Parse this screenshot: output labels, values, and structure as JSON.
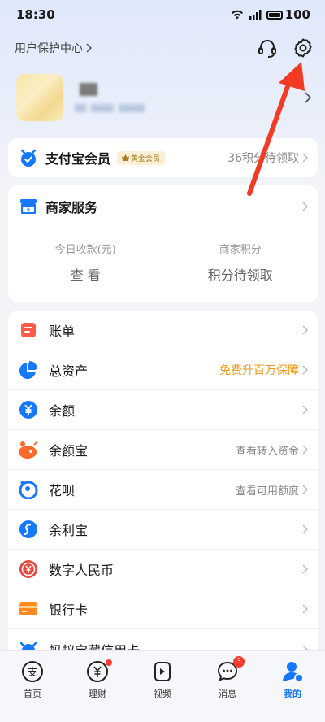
{
  "status_bar": {
    "time": "18:30",
    "battery": "100"
  },
  "header": {
    "protect_center": "用户保护中心"
  },
  "member": {
    "title": "支付宝会员",
    "badge": "黄金会员",
    "right_text": "36积分待领取"
  },
  "merchant": {
    "title": "商家服务",
    "stats": [
      {
        "label": "今日收款(元)",
        "value": "查 看"
      },
      {
        "label": "商家积分",
        "value": "积分待领取"
      }
    ]
  },
  "menu": [
    {
      "label": "账单",
      "right": "",
      "icon": "bill-icon",
      "color": "#ff5a4a"
    },
    {
      "label": "总资产",
      "right": "免费升百万保障",
      "right_style": "orange",
      "icon": "pie-chart-icon",
      "color": "#1677ff"
    },
    {
      "label": "余额",
      "right": "",
      "icon": "yuan-coin-icon",
      "color": "#1677ff"
    },
    {
      "label": "余额宝",
      "right": "查看转入资金",
      "icon": "yuebao-icon",
      "color": "#ff6a2b"
    },
    {
      "label": "花呗",
      "right": "查看可用额度",
      "icon": "huabei-icon",
      "color": "#1677ff"
    },
    {
      "label": "余利宝",
      "right": "",
      "icon": "yulibao-icon",
      "color": "#1677ff"
    },
    {
      "label": "数字人民币",
      "right": "",
      "icon": "digital-rmb-icon",
      "color": "#e8473b"
    },
    {
      "label": "银行卡",
      "right": "",
      "icon": "bank-card-icon",
      "color": "#ff8a1f"
    },
    {
      "label": "蚂蚁宝藏信用卡",
      "right": "",
      "icon": "credit-card-icon",
      "color": "#1677ff"
    }
  ],
  "tabs": [
    {
      "label": "首页",
      "icon": "alipay-home-icon"
    },
    {
      "label": "理财",
      "icon": "wealth-icon",
      "dot": true
    },
    {
      "label": "视频",
      "icon": "video-icon"
    },
    {
      "label": "消息",
      "icon": "message-icon",
      "badge": "3"
    },
    {
      "label": "我的",
      "icon": "me-icon",
      "active": true
    }
  ],
  "colors": {
    "accent": "#1677ff",
    "orange": "#f09a1a",
    "badge_red": "#ff3b30",
    "annotation": "#f23a24"
  }
}
